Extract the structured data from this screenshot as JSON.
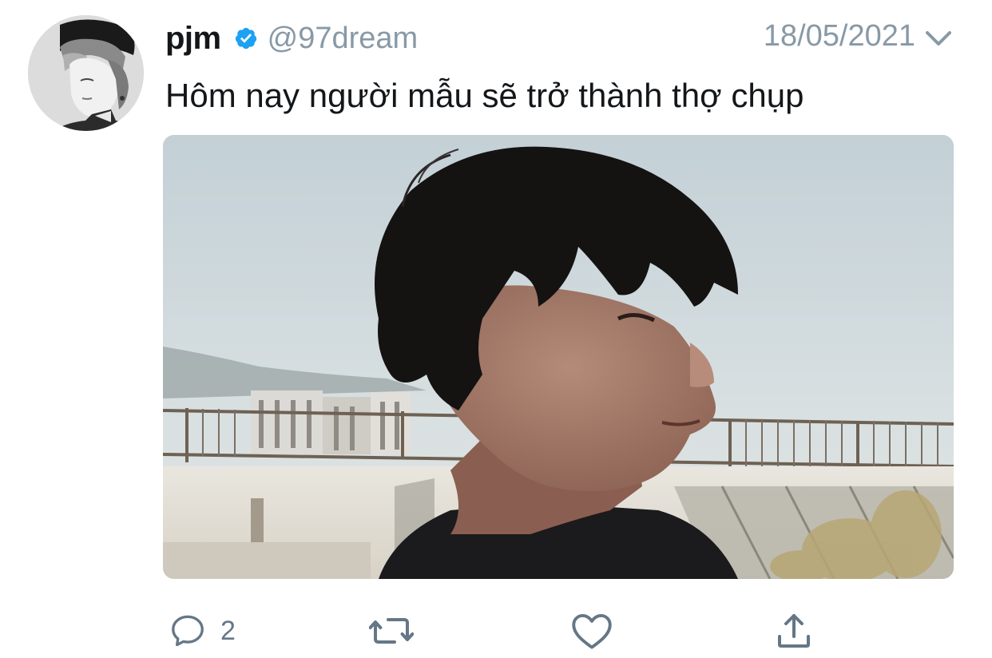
{
  "tweet": {
    "author": {
      "display_name": "pjm",
      "handle": "@97dream",
      "verified": true,
      "avatar_icon": "avatar-icon"
    },
    "date": "18/05/2021",
    "text": "Hôm nay người mẫu sẽ trở thành thợ chụp",
    "media": {
      "type": "photo"
    },
    "actions": {
      "reply_count": "2",
      "icons": [
        "reply-icon",
        "retweet-icon",
        "like-icon",
        "share-icon"
      ]
    }
  },
  "colors": {
    "text_primary": "#14171a",
    "text_secondary": "#8899a6",
    "action_icon": "#657786",
    "verified_blue": "#1da1f2"
  }
}
